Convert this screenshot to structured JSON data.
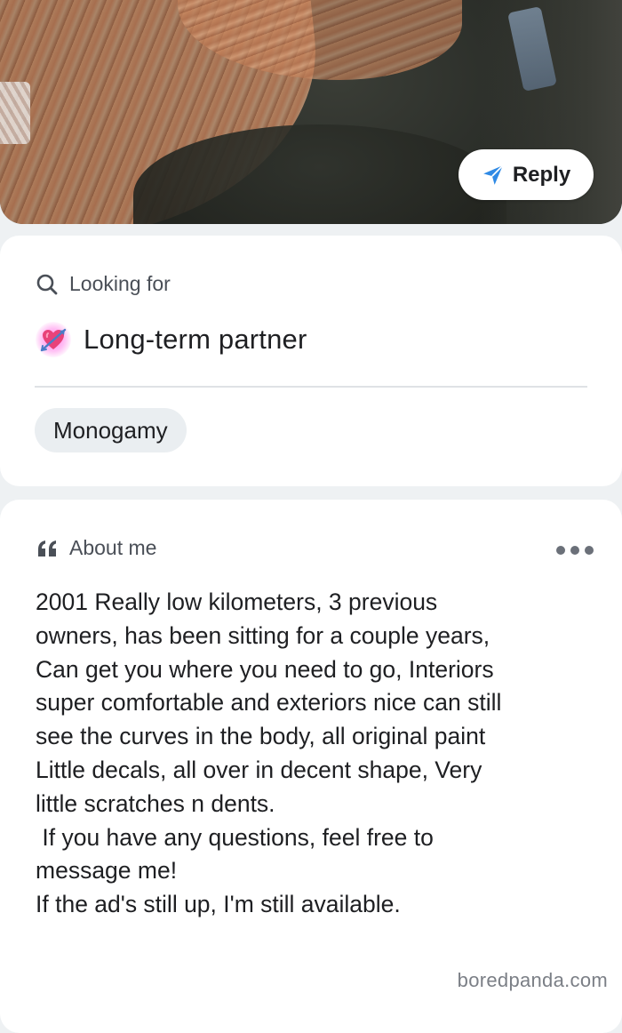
{
  "profile_photo": {
    "reply_button_label": "Reply",
    "reply_icon": "send-arrow-icon"
  },
  "looking_for": {
    "heading": "Looking for",
    "heading_icon": "search-icon",
    "value_icon": "heart-with-arrow-icon",
    "value": "Long-term partner",
    "tag": "Monogamy"
  },
  "about_me": {
    "heading": "About me",
    "heading_icon": "quote-icon",
    "menu_icon": "more-options-icon",
    "text": "2001 Really low kilometers, 3 previous\nowners, has been sitting for a couple years,\nCan get you where you need to go, Interiors\nsuper comfortable and exteriors nice can still\nsee the curves in the body, all original paint\nLittle decals, all over in decent shape, Very\nlittle scratches n dents.\n If you have any questions, feel free to\nmessage me!\nIf the ad's still up, I'm still available."
  },
  "watermark": "boredpanda.com",
  "colors": {
    "background": "#eef1f3",
    "card": "#ffffff",
    "chip": "#eaeef1",
    "accent_blue": "#2f8ae5",
    "muted_text": "#4a4f57",
    "heart_glow": "#ff78e6"
  }
}
